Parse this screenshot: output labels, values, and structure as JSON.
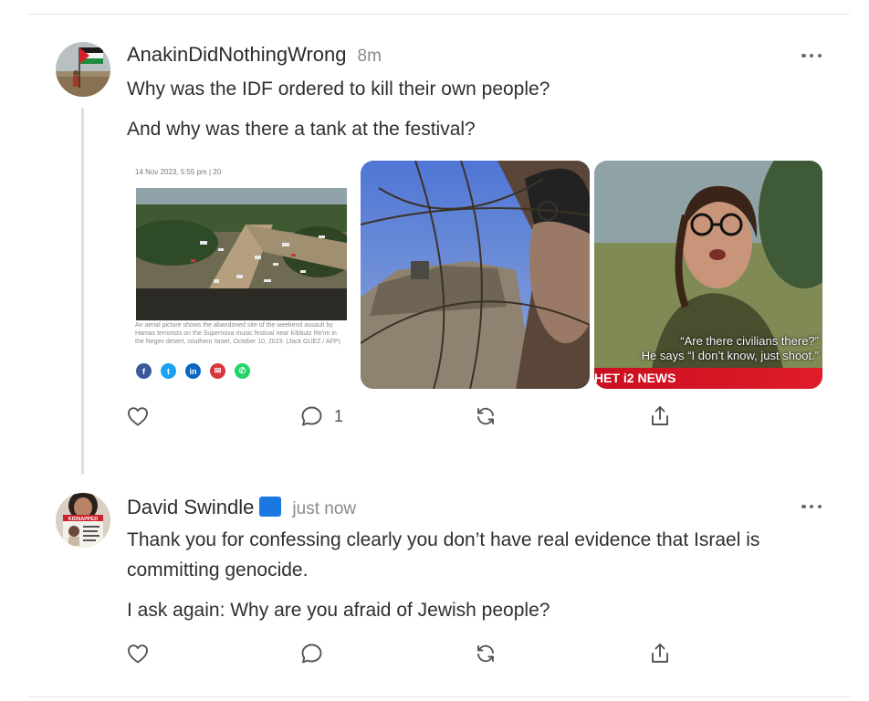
{
  "comments": [
    {
      "username": "AnakinDidNothingWrong",
      "timestamp": "8m",
      "paragraphs": [
        "Why was the IDF ordered to kill their own people?",
        "And why was there a tank at the festival?"
      ],
      "media": {
        "article": {
          "meta": "14 Nov 2023, 5:55 pm  |  20",
          "caption": "An aerial picture shows the abandoned site of the weekend assault by Hamas terrorists on the Supernova music festival near Kibbutz Re'im in the Negev desert, southern Israel, October 10, 2023. (Jack GUEZ / AFP)",
          "share_icons": [
            "facebook-icon",
            "twitter-icon",
            "linkedin-icon",
            "email-icon",
            "whatsapp-icon"
          ]
        },
        "video_subtitle_line1": "“Are there civilians there?”",
        "video_subtitle_line2": "He says “I don’t know, just shoot.”",
        "news_bar": "HET i2 NEWS"
      },
      "actions": {
        "like_icon": "heart-icon",
        "reply_icon": "comment-icon",
        "reply_count": "1",
        "restack_icon": "restack-icon",
        "share_icon": "share-icon"
      }
    },
    {
      "username": "David Swindle",
      "badge_icon": "blue-square-emoji",
      "timestamp": "just now",
      "paragraphs": [
        "Thank you for confessing clearly you don’t have real evidence that Israel is committing genocide.",
        "I ask again: Why are you afraid of Jewish people?"
      ],
      "avatar_text": "KIDNAPPED",
      "actions": {
        "like_icon": "heart-icon",
        "reply_icon": "comment-icon",
        "restack_icon": "restack-icon",
        "share_icon": "share-icon"
      }
    }
  ],
  "colors": {
    "text": "#2f2f2f",
    "muted": "#8a8a8a",
    "thread_line": "#dedede",
    "news_red": "#d8172a",
    "blue_square": "#1a78e0"
  }
}
